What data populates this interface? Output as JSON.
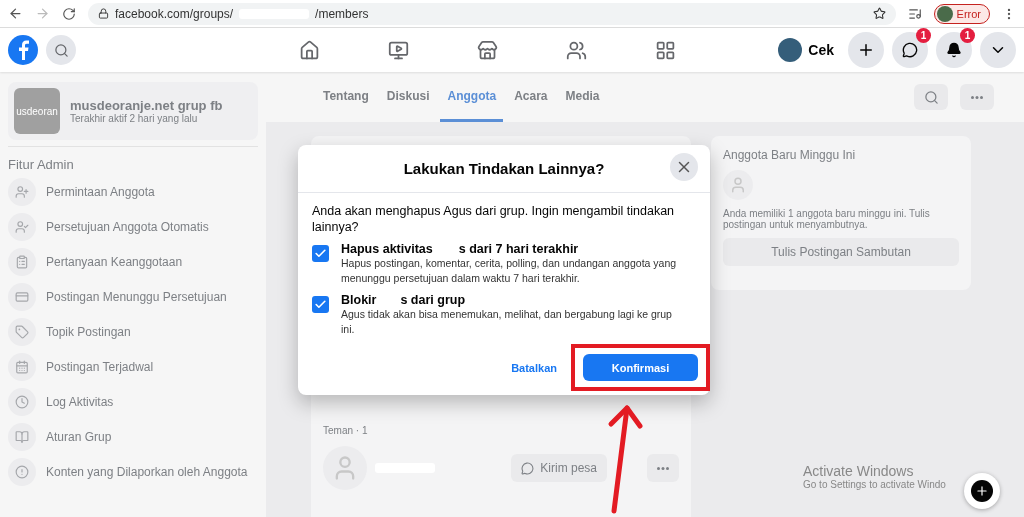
{
  "browser": {
    "url_start": "facebook.com/groups/",
    "url_end": "/members",
    "profile_label": "Error"
  },
  "nav": {
    "profile_name": "Cek",
    "messenger_badge": "1",
    "notifications_badge": "1",
    "tabs": [
      {
        "kind": "home",
        "selected": false
      },
      {
        "kind": "watch",
        "selected": false
      },
      {
        "kind": "marketplace",
        "selected": false
      },
      {
        "kind": "groups",
        "selected": false
      },
      {
        "kind": "gaming",
        "selected": false
      }
    ]
  },
  "sidebar": {
    "group_thumb": "usdeoran",
    "group_name": "musdeoranje.net grup fb",
    "group_status": "Terakhir aktif 2 hari yang lalu",
    "section": "Fitur Admin",
    "items": [
      {
        "kind": "person-add",
        "label": "Permintaan Anggota"
      },
      {
        "kind": "person-check",
        "label": "Persetujuan Anggota Otomatis"
      },
      {
        "kind": "questions",
        "label": "Pertanyaan Keanggotaan"
      },
      {
        "kind": "card",
        "label": "Postingan Menunggu Persetujuan"
      },
      {
        "kind": "tag",
        "label": "Topik Postingan"
      },
      {
        "kind": "calendar",
        "label": "Postingan Terjadwal"
      },
      {
        "kind": "clock",
        "label": "Log Aktivitas"
      },
      {
        "kind": "book",
        "label": "Aturan Grup"
      },
      {
        "kind": "alert",
        "label": "Konten yang Dilaporkan oleh Anggota"
      }
    ]
  },
  "group_tabs": [
    {
      "label": "Tentang",
      "selected": false
    },
    {
      "label": "Diskusi",
      "selected": false
    },
    {
      "label": "Anggota",
      "selected": true
    },
    {
      "label": "Acara",
      "selected": false
    },
    {
      "label": "Media",
      "selected": false
    }
  ],
  "friends": {
    "heading": "Teman · 1",
    "message_button": "Kirim pesa"
  },
  "new_members": {
    "title": "Anggota Baru Minggu Ini",
    "text": "Anda memiliki 1 anggota baru minggu ini. Tulis postingan untuk menyambutnya.",
    "button": "Tulis Postingan Sambutan"
  },
  "dialog": {
    "title": "Lakukan Tindakan Lainnya?",
    "intro": "Anda akan menghapus Agus dari grup. Ingin mengambil tindakan lainnya?",
    "options": [
      {
        "title_start": "Hapus aktivitas",
        "title_end": "s dari 7 hari terakhir",
        "description": "Hapus postingan, komentar, cerita, polling, dan undangan anggota yang menunggu persetujuan dalam waktu 7 hari terakhir.",
        "checked": true
      },
      {
        "title_start": "Blokir",
        "title_end": "s dari grup",
        "description": "Agus tidak akan bisa menemukan, melihat, dan bergabung lagi ke grup ini.",
        "checked": true
      }
    ],
    "cancel": "Batalkan",
    "confirm": "Konfirmasi"
  },
  "watermark_os": {
    "title": "Activate Windows",
    "subtitle": "Go to Settings to activate Windo"
  }
}
